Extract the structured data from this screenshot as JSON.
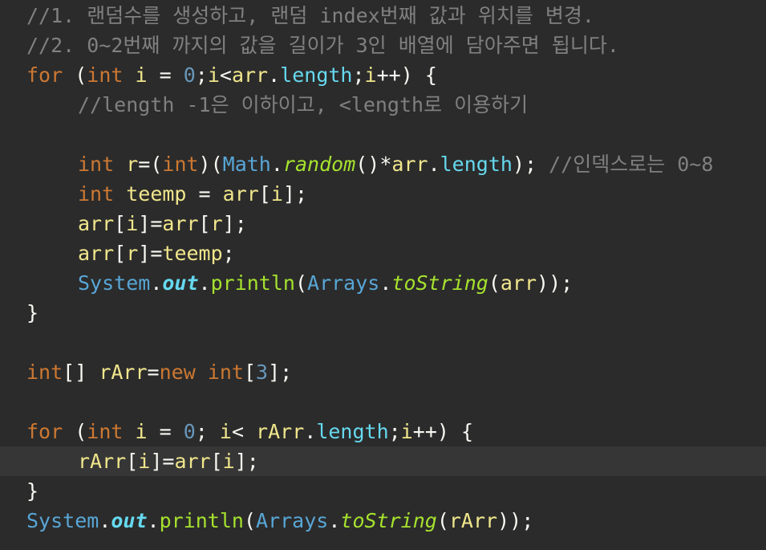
{
  "editor": {
    "lines": [
      {
        "indent": 0,
        "tokens": [
          {
            "t": "//1. 랜덤수를 생성하고, 랜덤 index번째 값과 위치를 변경.",
            "c": "comment"
          }
        ]
      },
      {
        "indent": 0,
        "tokens": [
          {
            "t": "//2. 0~2번째 까지의 값을 길이가 3인 배열에 담아주면 됩니다.",
            "c": "comment"
          }
        ]
      },
      {
        "indent": 0,
        "tokens": [
          {
            "t": "for",
            "c": "keyword"
          },
          {
            "t": " (",
            "c": "plain"
          },
          {
            "t": "int",
            "c": "keyword"
          },
          {
            "t": " ",
            "c": "plain"
          },
          {
            "t": "i",
            "c": "var"
          },
          {
            "t": " = ",
            "c": "plain"
          },
          {
            "t": "0",
            "c": "number"
          },
          {
            "t": ";",
            "c": "plain"
          },
          {
            "t": "i",
            "c": "var"
          },
          {
            "t": "<",
            "c": "plain"
          },
          {
            "t": "arr",
            "c": "var"
          },
          {
            "t": ".",
            "c": "plain"
          },
          {
            "t": "length",
            "c": "field"
          },
          {
            "t": ";",
            "c": "plain"
          },
          {
            "t": "i",
            "c": "var"
          },
          {
            "t": "++) {",
            "c": "plain"
          }
        ]
      },
      {
        "indent": 1,
        "tokens": [
          {
            "t": "//length -1은 이하이고, <length로 이용하기",
            "c": "comment"
          }
        ]
      },
      {
        "indent": 0,
        "tokens": []
      },
      {
        "indent": 1,
        "tokens": [
          {
            "t": "int",
            "c": "keyword"
          },
          {
            "t": " ",
            "c": "plain"
          },
          {
            "t": "r",
            "c": "var"
          },
          {
            "t": "=(",
            "c": "plain"
          },
          {
            "t": "int",
            "c": "keyword"
          },
          {
            "t": ")(",
            "c": "plain"
          },
          {
            "t": "Math",
            "c": "class"
          },
          {
            "t": ".",
            "c": "plain"
          },
          {
            "t": "random",
            "c": "italic"
          },
          {
            "t": "()*",
            "c": "plain"
          },
          {
            "t": "arr",
            "c": "var"
          },
          {
            "t": ".",
            "c": "plain"
          },
          {
            "t": "length",
            "c": "field"
          },
          {
            "t": "); ",
            "c": "plain"
          },
          {
            "t": "//인덱스로는 0~8",
            "c": "comment"
          }
        ]
      },
      {
        "indent": 1,
        "tokens": [
          {
            "t": "int",
            "c": "keyword"
          },
          {
            "t": " ",
            "c": "plain"
          },
          {
            "t": "teemp",
            "c": "var"
          },
          {
            "t": " = ",
            "c": "plain"
          },
          {
            "t": "arr",
            "c": "var"
          },
          {
            "t": "[",
            "c": "plain"
          },
          {
            "t": "i",
            "c": "var"
          },
          {
            "t": "];",
            "c": "plain"
          }
        ]
      },
      {
        "indent": 1,
        "tokens": [
          {
            "t": "arr",
            "c": "var"
          },
          {
            "t": "[",
            "c": "plain"
          },
          {
            "t": "i",
            "c": "var"
          },
          {
            "t": "]=",
            "c": "plain"
          },
          {
            "t": "arr",
            "c": "var"
          },
          {
            "t": "[",
            "c": "plain"
          },
          {
            "t": "r",
            "c": "var"
          },
          {
            "t": "];",
            "c": "plain"
          }
        ]
      },
      {
        "indent": 1,
        "tokens": [
          {
            "t": "arr",
            "c": "var"
          },
          {
            "t": "[",
            "c": "plain"
          },
          {
            "t": "r",
            "c": "var"
          },
          {
            "t": "]=",
            "c": "plain"
          },
          {
            "t": "teemp",
            "c": "var"
          },
          {
            "t": ";",
            "c": "plain"
          }
        ]
      },
      {
        "indent": 1,
        "tokens": [
          {
            "t": "System",
            "c": "class"
          },
          {
            "t": ".",
            "c": "plain"
          },
          {
            "t": "out",
            "c": "static"
          },
          {
            "t": ".",
            "c": "plain"
          },
          {
            "t": "println",
            "c": "method"
          },
          {
            "t": "(",
            "c": "plain"
          },
          {
            "t": "Arrays",
            "c": "class"
          },
          {
            "t": ".",
            "c": "plain"
          },
          {
            "t": "toString",
            "c": "italic"
          },
          {
            "t": "(",
            "c": "plain"
          },
          {
            "t": "arr",
            "c": "var"
          },
          {
            "t": "));",
            "c": "plain"
          }
        ]
      },
      {
        "indent": 0,
        "tokens": [
          {
            "t": "}",
            "c": "plain"
          }
        ]
      },
      {
        "indent": 0,
        "tokens": []
      },
      {
        "indent": 0,
        "tokens": [
          {
            "t": "int",
            "c": "keyword"
          },
          {
            "t": "[] ",
            "c": "plain"
          },
          {
            "t": "rArr",
            "c": "var"
          },
          {
            "t": "=",
            "c": "plain"
          },
          {
            "t": "new",
            "c": "keyword"
          },
          {
            "t": " ",
            "c": "plain"
          },
          {
            "t": "int",
            "c": "keyword"
          },
          {
            "t": "[",
            "c": "plain"
          },
          {
            "t": "3",
            "c": "number"
          },
          {
            "t": "];",
            "c": "plain"
          }
        ]
      },
      {
        "indent": 0,
        "tokens": []
      },
      {
        "indent": 0,
        "tokens": [
          {
            "t": "for",
            "c": "keyword"
          },
          {
            "t": " (",
            "c": "plain"
          },
          {
            "t": "int",
            "c": "keyword"
          },
          {
            "t": " ",
            "c": "plain"
          },
          {
            "t": "i",
            "c": "var"
          },
          {
            "t": " = ",
            "c": "plain"
          },
          {
            "t": "0",
            "c": "number"
          },
          {
            "t": "; ",
            "c": "plain"
          },
          {
            "t": "i",
            "c": "var"
          },
          {
            "t": "< ",
            "c": "plain"
          },
          {
            "t": "rArr",
            "c": "var"
          },
          {
            "t": ".",
            "c": "plain"
          },
          {
            "t": "length",
            "c": "field"
          },
          {
            "t": ";",
            "c": "plain"
          },
          {
            "t": "i",
            "c": "var"
          },
          {
            "t": "++) {",
            "c": "plain"
          }
        ]
      },
      {
        "indent": 1,
        "current": true,
        "tokens": [
          {
            "t": "rArr",
            "c": "var"
          },
          {
            "t": "[",
            "c": "plain"
          },
          {
            "t": "i",
            "c": "var"
          },
          {
            "t": "]=",
            "c": "plain"
          },
          {
            "t": "arr",
            "c": "var"
          },
          {
            "t": "[",
            "c": "plain"
          },
          {
            "t": "i",
            "c": "var"
          },
          {
            "t": "];",
            "c": "plain"
          }
        ]
      },
      {
        "indent": 0,
        "tokens": [
          {
            "t": "}",
            "c": "plain"
          }
        ]
      },
      {
        "indent": 0,
        "tokens": [
          {
            "t": "System",
            "c": "class"
          },
          {
            "t": ".",
            "c": "plain"
          },
          {
            "t": "out",
            "c": "static"
          },
          {
            "t": ".",
            "c": "plain"
          },
          {
            "t": "println",
            "c": "method"
          },
          {
            "t": "(",
            "c": "plain"
          },
          {
            "t": "Arrays",
            "c": "class"
          },
          {
            "t": ".",
            "c": "plain"
          },
          {
            "t": "toString",
            "c": "italic"
          },
          {
            "t": "(",
            "c": "plain"
          },
          {
            "t": "rArr",
            "c": "var"
          },
          {
            "t": "));",
            "c": "plain"
          }
        ]
      }
    ]
  }
}
